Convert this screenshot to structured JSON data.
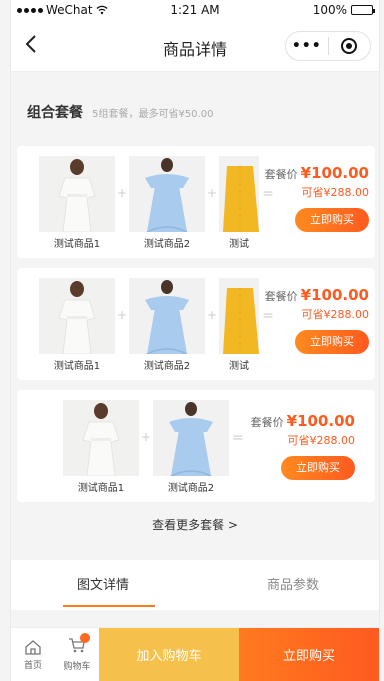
{
  "status_bar": {
    "carrier": "WeChat",
    "time": "1:21 AM",
    "battery": "100%"
  },
  "nav": {
    "title": "商品详情",
    "back_icon": "chevron-left-icon",
    "more_label": "•••"
  },
  "combo": {
    "title": "组合套餐",
    "subtitle": "5组套餐，最多可省¥50.00"
  },
  "cards": [
    {
      "products": [
        "测试商品1",
        "测试商品2",
        "测试"
      ],
      "price_label": "套餐价",
      "price": "¥100.00",
      "save": "可省¥288.00",
      "buy_label": "立即购买"
    },
    {
      "products": [
        "测试商品1",
        "测试商品2",
        "测试"
      ],
      "price_label": "套餐价",
      "price": "¥100.00",
      "save": "可省¥288.00",
      "buy_label": "立即购买"
    },
    {
      "products": [
        "测试商品1",
        "测试商品2"
      ],
      "price_label": "套餐价",
      "price": "¥100.00",
      "save": "可省¥288.00",
      "buy_label": "立即购买"
    }
  ],
  "operators": {
    "plus": "+",
    "equals": "="
  },
  "more_combos": "查看更多套餐 >",
  "tabs": [
    {
      "label": "图文详情",
      "active": true
    },
    {
      "label": "商品参数",
      "active": false
    }
  ],
  "bottom": {
    "home": "首页",
    "cart": "购物车",
    "add_cart": "加入购物车",
    "buy_now": "立即购买"
  },
  "colors": {
    "accent": "#ff5a1f",
    "add_cart_bg": "#f5c14a",
    "dress_white": "#f7f7f5",
    "dress_blue": "#a9cbee",
    "dress_yellow": "#f2b823"
  }
}
